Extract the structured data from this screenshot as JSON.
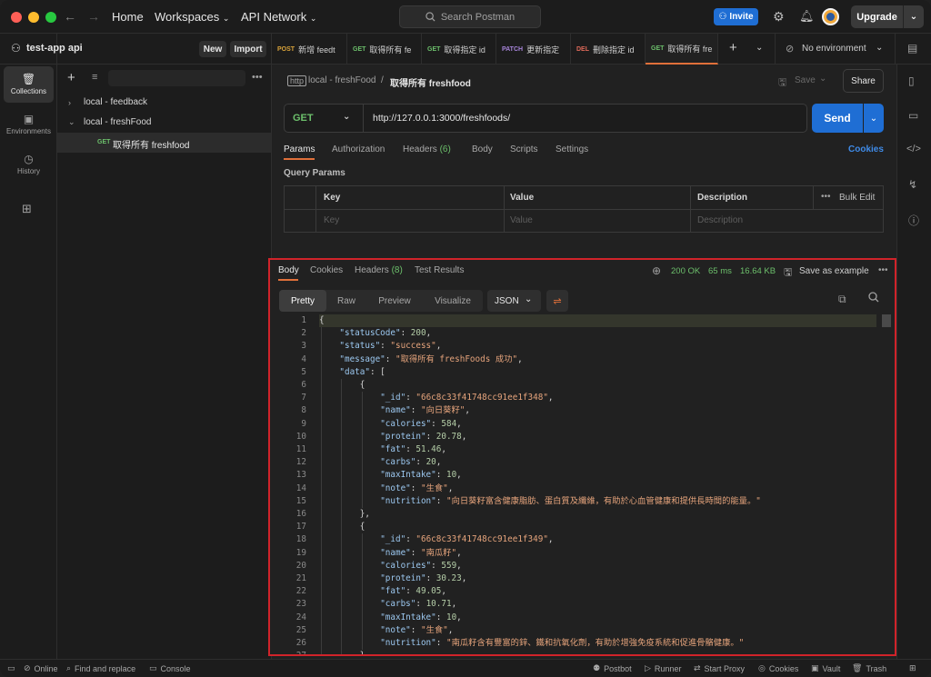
{
  "titlebar": {
    "home": "Home",
    "workspaces": "Workspaces",
    "api_network": "API Network",
    "search_placeholder": "Search Postman",
    "invite": "Invite",
    "upgrade": "Upgrade"
  },
  "workspace": {
    "name": "test-app api",
    "new_label": "New",
    "import_label": "Import"
  },
  "leftnav": [
    {
      "label": "Collections",
      "icon": "collections-icon"
    },
    {
      "label": "Environments",
      "icon": "environments-icon"
    },
    {
      "label": "History",
      "icon": "history-icon"
    }
  ],
  "tree": {
    "items": [
      {
        "label": "local - feedback"
      },
      {
        "label": "local - freshFood"
      },
      {
        "method": "GET",
        "label": "取得所有 freshfood"
      }
    ]
  },
  "tabs": [
    {
      "method": "POST",
      "label": "新增 feedt"
    },
    {
      "method": "GET",
      "label": "取得所有 fe"
    },
    {
      "method": "GET",
      "label": "取得指定 id"
    },
    {
      "method": "PATCH",
      "label": "更新指定"
    },
    {
      "method": "DEL",
      "label": "刪除指定 id"
    },
    {
      "method": "GET",
      "label": "取得所有 fre"
    }
  ],
  "environment": "No environment",
  "request": {
    "breadcrumb_parent": "local - freshFood",
    "breadcrumb_sep": "/",
    "title": "取得所有 freshfood",
    "save": "Save",
    "share": "Share",
    "method": "GET",
    "url": "http://127.0.0.1:3000/freshfoods/",
    "send": "Send",
    "tabs": {
      "params": "Params",
      "authorization": "Authorization",
      "headers": "Headers",
      "headers_count": "(6)",
      "body": "Body",
      "scripts": "Scripts",
      "settings": "Settings",
      "cookies": "Cookies"
    },
    "query_params_label": "Query Params",
    "table": {
      "headers": [
        "Key",
        "Value",
        "Description"
      ],
      "bulk_edit": "Bulk Edit",
      "placeholders": [
        "Key",
        "Value",
        "Description"
      ]
    }
  },
  "response": {
    "tabs": {
      "body": "Body",
      "cookies": "Cookies",
      "headers": "Headers",
      "headers_count": "(8)",
      "test_results": "Test Results"
    },
    "status": "200 OK",
    "time": "65 ms",
    "size": "16.64 KB",
    "save_example": "Save as example",
    "formats": [
      "Pretty",
      "Raw",
      "Preview",
      "Visualize"
    ],
    "language": "JSON"
  },
  "code_lines": [
    {
      "n": "1",
      "i": 0,
      "t": [
        [
          "p",
          "{"
        ]
      ]
    },
    {
      "n": "2",
      "i": 1,
      "t": [
        [
          "k",
          "\"statusCode\""
        ],
        [
          "p",
          ": "
        ],
        [
          "n",
          "200"
        ],
        [
          "p",
          ","
        ]
      ]
    },
    {
      "n": "3",
      "i": 1,
      "t": [
        [
          "k",
          "\"status\""
        ],
        [
          "p",
          ": "
        ],
        [
          "s",
          "\"success\""
        ],
        [
          "p",
          ","
        ]
      ]
    },
    {
      "n": "4",
      "i": 1,
      "t": [
        [
          "k",
          "\"message\""
        ],
        [
          "p",
          ": "
        ],
        [
          "s",
          "\"取得所有 freshFoods 成功\""
        ],
        [
          "p",
          ","
        ]
      ]
    },
    {
      "n": "5",
      "i": 1,
      "t": [
        [
          "k",
          "\"data\""
        ],
        [
          "p",
          ": ["
        ]
      ]
    },
    {
      "n": "6",
      "i": 2,
      "t": [
        [
          "p",
          "{"
        ]
      ]
    },
    {
      "n": "7",
      "i": 3,
      "t": [
        [
          "k",
          "\"_id\""
        ],
        [
          "p",
          ": "
        ],
        [
          "s",
          "\"66c8c33f41748cc91ee1f348\""
        ],
        [
          "p",
          ","
        ]
      ]
    },
    {
      "n": "8",
      "i": 3,
      "t": [
        [
          "k",
          "\"name\""
        ],
        [
          "p",
          ": "
        ],
        [
          "s",
          "\"向日葵籽\""
        ],
        [
          "p",
          ","
        ]
      ]
    },
    {
      "n": "9",
      "i": 3,
      "t": [
        [
          "k",
          "\"calories\""
        ],
        [
          "p",
          ": "
        ],
        [
          "n",
          "584"
        ],
        [
          "p",
          ","
        ]
      ]
    },
    {
      "n": "10",
      "i": 3,
      "t": [
        [
          "k",
          "\"protein\""
        ],
        [
          "p",
          ": "
        ],
        [
          "n",
          "20.78"
        ],
        [
          "p",
          ","
        ]
      ]
    },
    {
      "n": "11",
      "i": 3,
      "t": [
        [
          "k",
          "\"fat\""
        ],
        [
          "p",
          ": "
        ],
        [
          "n",
          "51.46"
        ],
        [
          "p",
          ","
        ]
      ]
    },
    {
      "n": "12",
      "i": 3,
      "t": [
        [
          "k",
          "\"carbs\""
        ],
        [
          "p",
          ": "
        ],
        [
          "n",
          "20"
        ],
        [
          "p",
          ","
        ]
      ]
    },
    {
      "n": "13",
      "i": 3,
      "t": [
        [
          "k",
          "\"maxIntake\""
        ],
        [
          "p",
          ": "
        ],
        [
          "n",
          "10"
        ],
        [
          "p",
          ","
        ]
      ]
    },
    {
      "n": "14",
      "i": 3,
      "t": [
        [
          "k",
          "\"note\""
        ],
        [
          "p",
          ": "
        ],
        [
          "s",
          "\"生食\""
        ],
        [
          "p",
          ","
        ]
      ]
    },
    {
      "n": "15",
      "i": 3,
      "t": [
        [
          "k",
          "\"nutrition\""
        ],
        [
          "p",
          ": "
        ],
        [
          "s",
          "\"向日葵籽富含健康脂肪、蛋白質及纖維，有助於心血管健康和提供長時間的能量。\""
        ]
      ]
    },
    {
      "n": "16",
      "i": 2,
      "t": [
        [
          "p",
          "},"
        ]
      ]
    },
    {
      "n": "17",
      "i": 2,
      "t": [
        [
          "p",
          "{"
        ]
      ]
    },
    {
      "n": "18",
      "i": 3,
      "t": [
        [
          "k",
          "\"_id\""
        ],
        [
          "p",
          ": "
        ],
        [
          "s",
          "\"66c8c33f41748cc91ee1f349\""
        ],
        [
          "p",
          ","
        ]
      ]
    },
    {
      "n": "19",
      "i": 3,
      "t": [
        [
          "k",
          "\"name\""
        ],
        [
          "p",
          ": "
        ],
        [
          "s",
          "\"南瓜籽\""
        ],
        [
          "p",
          ","
        ]
      ]
    },
    {
      "n": "20",
      "i": 3,
      "t": [
        [
          "k",
          "\"calories\""
        ],
        [
          "p",
          ": "
        ],
        [
          "n",
          "559"
        ],
        [
          "p",
          ","
        ]
      ]
    },
    {
      "n": "21",
      "i": 3,
      "t": [
        [
          "k",
          "\"protein\""
        ],
        [
          "p",
          ": "
        ],
        [
          "n",
          "30.23"
        ],
        [
          "p",
          ","
        ]
      ]
    },
    {
      "n": "22",
      "i": 3,
      "t": [
        [
          "k",
          "\"fat\""
        ],
        [
          "p",
          ": "
        ],
        [
          "n",
          "49.05"
        ],
        [
          "p",
          ","
        ]
      ]
    },
    {
      "n": "23",
      "i": 3,
      "t": [
        [
          "k",
          "\"carbs\""
        ],
        [
          "p",
          ": "
        ],
        [
          "n",
          "10.71"
        ],
        [
          "p",
          ","
        ]
      ]
    },
    {
      "n": "24",
      "i": 3,
      "t": [
        [
          "k",
          "\"maxIntake\""
        ],
        [
          "p",
          ": "
        ],
        [
          "n",
          "10"
        ],
        [
          "p",
          ","
        ]
      ]
    },
    {
      "n": "25",
      "i": 3,
      "t": [
        [
          "k",
          "\"note\""
        ],
        [
          "p",
          ": "
        ],
        [
          "s",
          "\"生食\""
        ],
        [
          "p",
          ","
        ]
      ]
    },
    {
      "n": "26",
      "i": 3,
      "t": [
        [
          "k",
          "\"nutrition\""
        ],
        [
          "p",
          ": "
        ],
        [
          "s",
          "\"南瓜籽含有豐富的鋅、鐵和抗氧化劑，有助於增強免疫系統和促進骨骼健康。\""
        ]
      ]
    },
    {
      "n": "27",
      "i": 2,
      "t": [
        [
          "p",
          "},"
        ]
      ]
    }
  ],
  "statusbar": {
    "online": "Online",
    "find_replace": "Find and replace",
    "console": "Console",
    "postbot": "Postbot",
    "runner": "Runner",
    "start_proxy": "Start Proxy",
    "cookies": "Cookies",
    "vault": "Vault",
    "trash": "Trash"
  },
  "colors": {
    "accent": "#1f6ed4",
    "highlight_border": "#d1232a",
    "tab_active": "#e0703a",
    "status_ok": "#6cbf6b"
  }
}
